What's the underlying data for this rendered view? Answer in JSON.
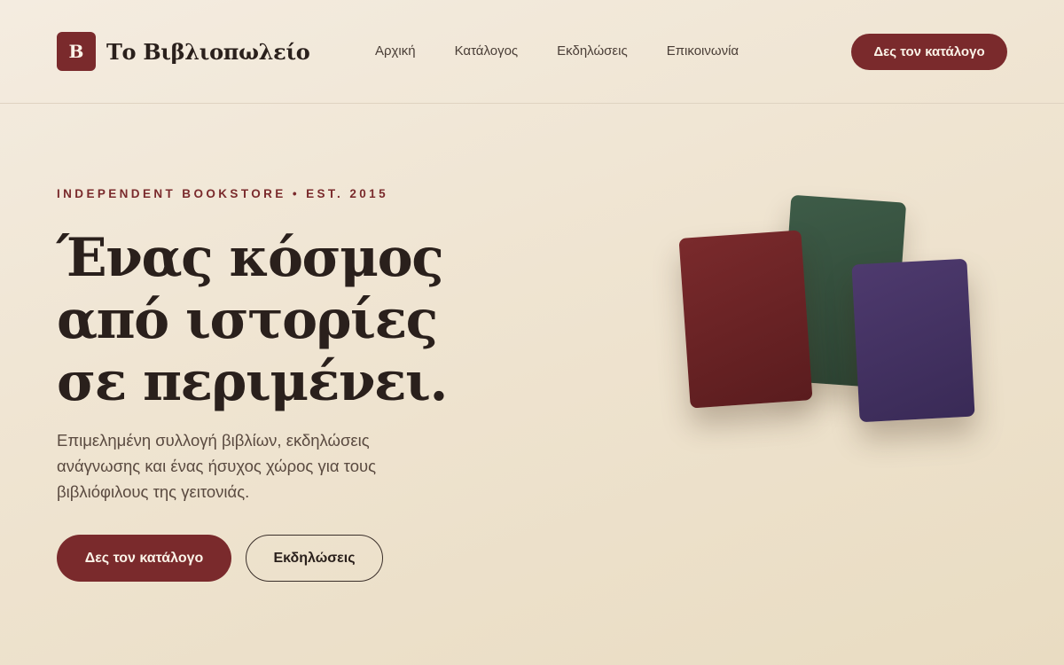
{
  "header": {
    "logo_mark": "B",
    "brand_name": "Το Βιβλιοπωλείο",
    "nav": [
      {
        "label": "Αρχική"
      },
      {
        "label": "Κατάλογος"
      },
      {
        "label": "Εκδηλώσεις"
      },
      {
        "label": "Επικοινωνία"
      }
    ],
    "cta_label": "Δες τον κατάλογο"
  },
  "hero": {
    "eyebrow": "INDEPENDENT BOOKSTORE • EST. 2015",
    "headline": "Ένας κόσμος από ιστορίες σε περιμένει.",
    "subtext": "Επιμελημένη συλλογή βιβλίων, εκδηλώσεις ανάγνωσης και ένας ήσυχος χώρος για τους βιβλιόφιλους της γειτονιάς.",
    "primary_button": "Δες τον κατάλογο",
    "secondary_button": "Εκδηλώσεις"
  },
  "colors": {
    "accent": "#7a2a2c",
    "book_red": "#7a2a2c",
    "book_green": "#3e5c48",
    "book_purple": "#4e3a6e",
    "text": "#2a201c"
  }
}
